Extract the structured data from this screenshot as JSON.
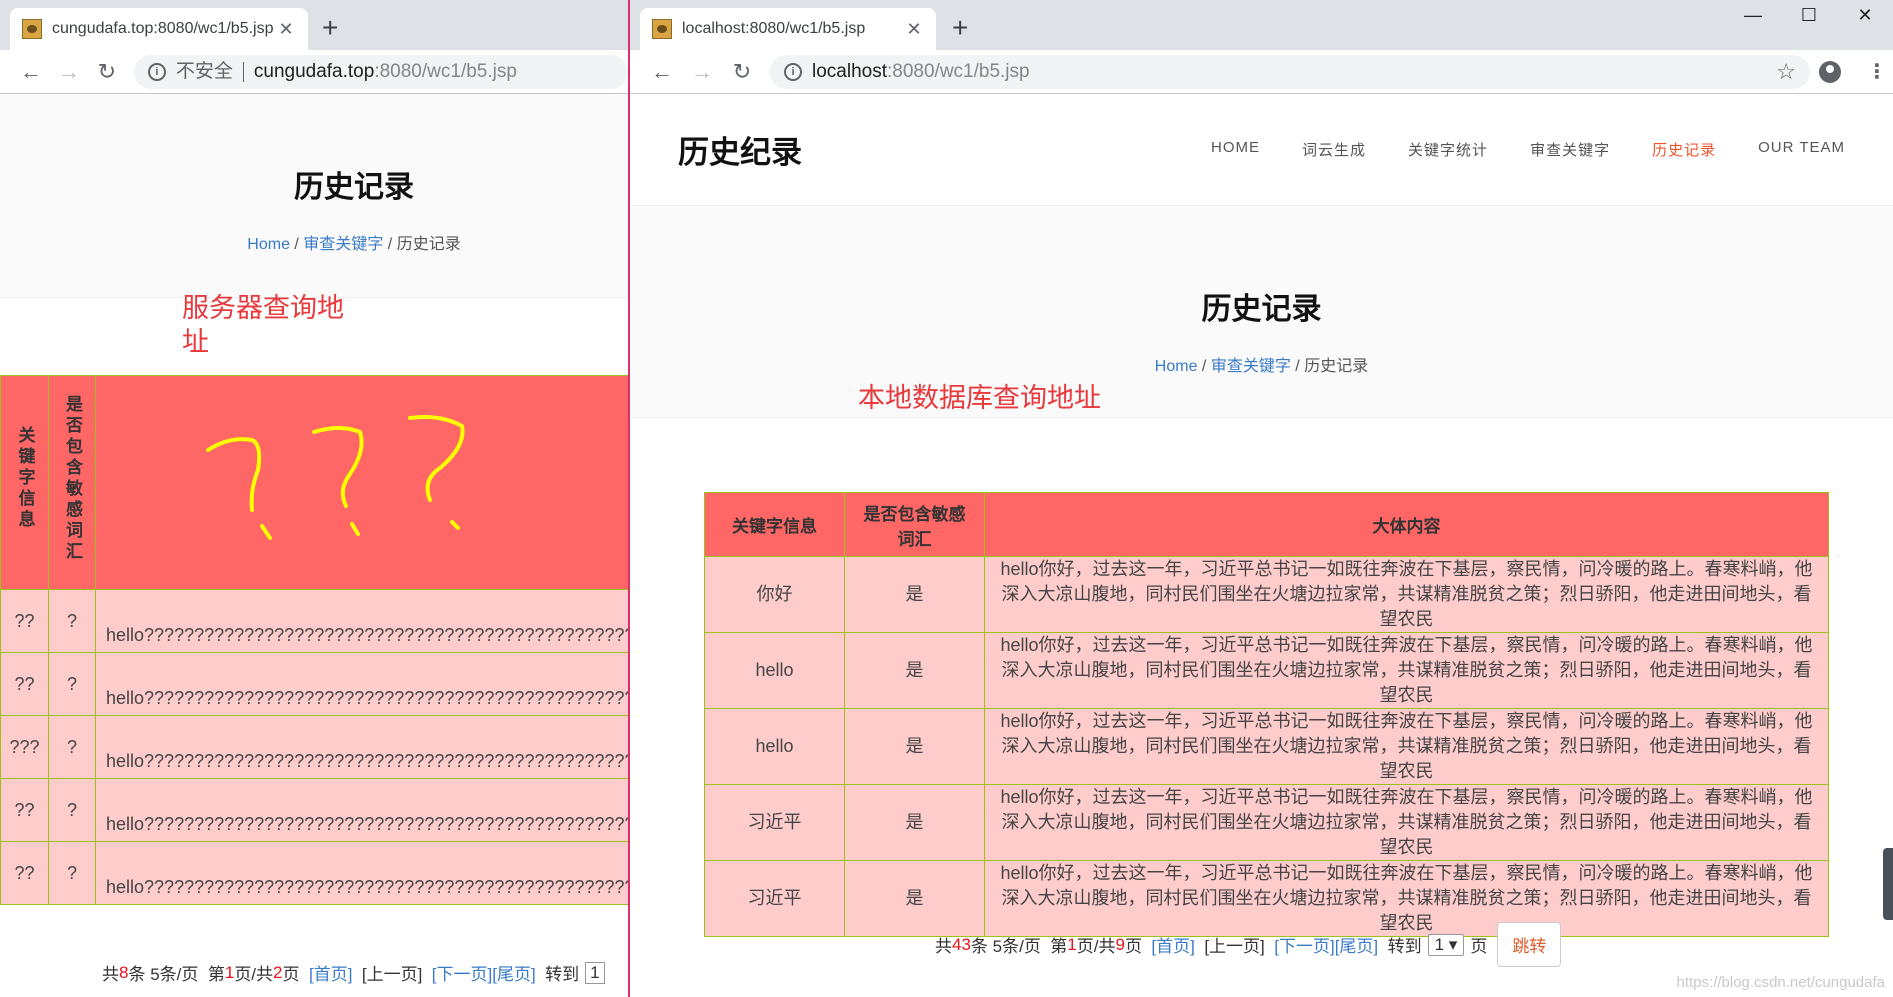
{
  "left_window": {
    "tab_title": "cungudafa.top:8080/wc1/b5.jsp",
    "omnibox": {
      "security_label": "不安全",
      "host": "cungudafa.top",
      "path": ":8080/wc1/b5.jsp"
    },
    "page_title": "历史记录",
    "breadcrumb": {
      "home": "Home",
      "parent": "审查关键字",
      "sep": " / ",
      "current": "历史记录"
    },
    "annotation": "服务器查询地址",
    "scribble_text": "???",
    "table": {
      "headers": [
        "关键字信息",
        "是否包含敏感词汇",
        ""
      ],
      "rows": [
        {
          "keyword": "??",
          "sensitive": "?",
          "content": "hello????????????????????????????????????????????????????"
        },
        {
          "keyword": "??",
          "sensitive": "?",
          "content": "hello????????????????????????????????????????????????????"
        },
        {
          "keyword": "???",
          "sensitive": "?",
          "content": "hello????????????????????????????????????????????????????"
        },
        {
          "keyword": "??",
          "sensitive": "?",
          "content": "hello????????????????????????????????????????????????????"
        },
        {
          "keyword": "??",
          "sensitive": "?",
          "content": "hello????????????????????????????????????????????????????"
        }
      ]
    },
    "pager": {
      "total_prefix": "共",
      "total": "8",
      "total_suffix": "条",
      "per_page": "5条/页",
      "page_prefix": "第",
      "page": "1",
      "page_mid": "页/共 ",
      "pages": "2",
      "page_suffix": "页",
      "first": "[首页]",
      "prev": "[上一页]",
      "next": "[下一页]",
      "last": "[尾页]",
      "goto": "转到",
      "goto_value": "1"
    }
  },
  "right_window": {
    "tab_title": "localhost:8080/wc1/b5.jsp",
    "omnibox": {
      "host": "localhost",
      "path": ":8080/wc1/b5.jsp"
    },
    "window_controls": {
      "minimize": "—",
      "maximize": "☐",
      "close": "✕"
    },
    "brand": "历史纪录",
    "nav": [
      {
        "label": "HOME",
        "active": false
      },
      {
        "label": "词云生成",
        "active": false
      },
      {
        "label": "关键字统计",
        "active": false
      },
      {
        "label": "审查关键字",
        "active": false
      },
      {
        "label": "历史记录",
        "active": true
      },
      {
        "label": "OUR TEAM",
        "active": false
      }
    ],
    "page_title": "历史记录",
    "breadcrumb": {
      "home": "Home",
      "parent": "审查关键字",
      "sep": " / ",
      "current": "历史记录"
    },
    "annotation": "本地数据库查询地址",
    "table": {
      "headers": [
        "关键字信息",
        "是否包含敏感词汇",
        "大体内容"
      ],
      "rows": [
        {
          "keyword": "你好",
          "sensitive": "是",
          "content": "hello你好，过去这一年，习近平总书记一如既往奔波在下基层，察民情，问冷暖的路上。春寒料峭，他深入大凉山腹地，同村民们围坐在火塘边拉家常，共谋精准脱贫之策；烈日骄阳，他走进田间地头，看望农民"
        },
        {
          "keyword": "hello",
          "sensitive": "是",
          "content": "hello你好，过去这一年，习近平总书记一如既往奔波在下基层，察民情，问冷暖的路上。春寒料峭，他深入大凉山腹地，同村民们围坐在火塘边拉家常，共谋精准脱贫之策；烈日骄阳，他走进田间地头，看望农民"
        },
        {
          "keyword": "hello",
          "sensitive": "是",
          "content": "hello你好，过去这一年，习近平总书记一如既往奔波在下基层，察民情，问冷暖的路上。春寒料峭，他深入大凉山腹地，同村民们围坐在火塘边拉家常，共谋精准脱贫之策；烈日骄阳，他走进田间地头，看望农民"
        },
        {
          "keyword": "习近平",
          "sensitive": "是",
          "content": "hello你好，过去这一年，习近平总书记一如既往奔波在下基层，察民情，问冷暖的路上。春寒料峭，他深入大凉山腹地，同村民们围坐在火塘边拉家常，共谋精准脱贫之策；烈日骄阳，他走进田间地头，看望农民"
        },
        {
          "keyword": "习近平",
          "sensitive": "是",
          "content": "hello你好，过去这一年，习近平总书记一如既往奔波在下基层，察民情，问冷暖的路上。春寒料峭，他深入大凉山腹地，同村民们围坐在火塘边拉家常，共谋精准脱贫之策；烈日骄阳，他走进田间地头，看望农民"
        }
      ]
    },
    "pager": {
      "total_prefix": "共",
      "total": "43",
      "total_suffix": "条",
      "per_page": "5条/页",
      "page_prefix": "第",
      "page": "1",
      "page_mid": "页/共 ",
      "pages": "9",
      "page_suffix": "页",
      "first": "[首页]",
      "prev": "[上一页]",
      "next": "[下一页]",
      "last": "[尾页]",
      "goto": "转到",
      "goto_value": "1",
      "page_unit": "页",
      "jump_label": "跳转"
    },
    "watermark": "https://blog.csdn.net/cungudafa"
  },
  "colors": {
    "header_red": "#ff6666",
    "cell_pink": "#ffcccc",
    "border_green": "#9cc11d",
    "active_nav": "#f0542c",
    "annotation_red": "#e8393d",
    "link_blue": "#3a7bc8"
  }
}
